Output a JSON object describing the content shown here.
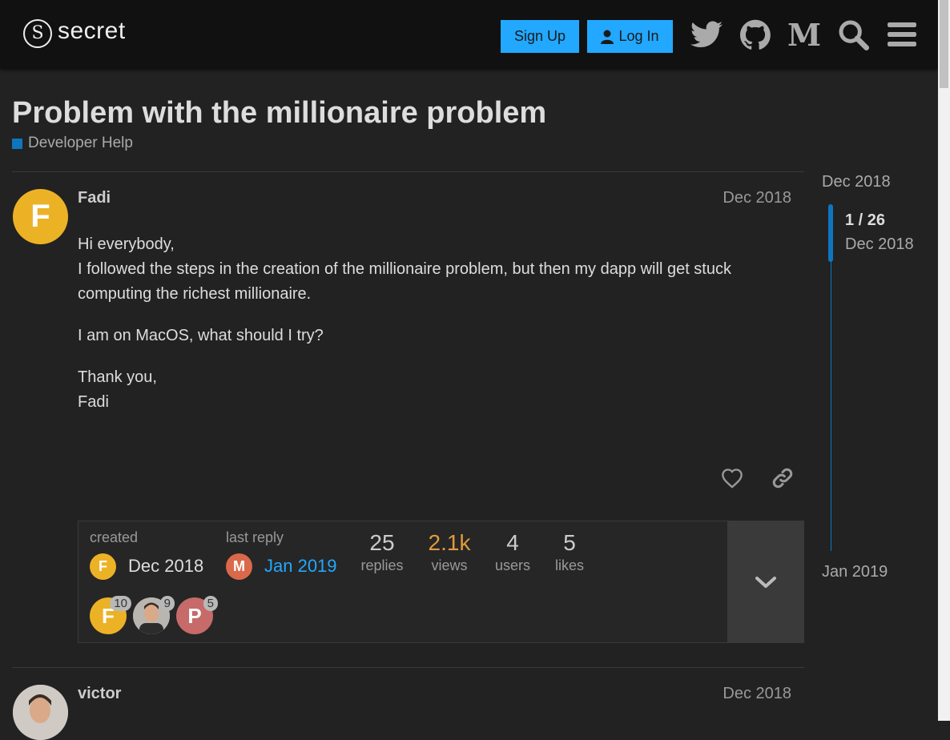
{
  "header": {
    "logo_text": "secret",
    "signup_label": "Sign Up",
    "login_label": "Log In"
  },
  "topic": {
    "title": "Problem with the millionaire problem",
    "category": "Developer Help",
    "category_color": "#0e76bd"
  },
  "post": {
    "avatar_letter": "F",
    "username": "Fadi",
    "date": "Dec 2018",
    "paragraphs": [
      [
        "Hi everybody,",
        "I followed the steps in the creation of the millionaire problem, but then my dapp will get stuck computing the richest millionaire."
      ],
      [
        "I am on MacOS, what should I try?"
      ],
      [
        "Thank you,",
        "Fadi"
      ]
    ]
  },
  "topic_map": {
    "created_label": "created",
    "created_avatar": "F",
    "created_date": "Dec 2018",
    "last_reply_label": "last reply",
    "last_reply_avatar": "M",
    "last_reply_date": "Jan 2019",
    "stats": [
      {
        "num": "25",
        "label": "replies",
        "color": "#cccccc"
      },
      {
        "num": "2.1k",
        "label": "views",
        "color": "#e09a3e"
      },
      {
        "num": "4",
        "label": "users",
        "color": "#cccccc"
      },
      {
        "num": "5",
        "label": "likes",
        "color": "#cccccc"
      }
    ],
    "participants": [
      {
        "letter": "F",
        "count": "10",
        "color": "#ecb226"
      },
      {
        "letter": "",
        "count": "9",
        "color": "#c7a893"
      },
      {
        "letter": "P",
        "count": "5",
        "color": "#c66a6a"
      }
    ]
  },
  "timeline": {
    "start": "Dec 2018",
    "position": "1 / 26",
    "position_date": "Dec 2018",
    "end": "Jan 2019"
  },
  "post2": {
    "username": "victor",
    "date": "Dec 2018"
  }
}
